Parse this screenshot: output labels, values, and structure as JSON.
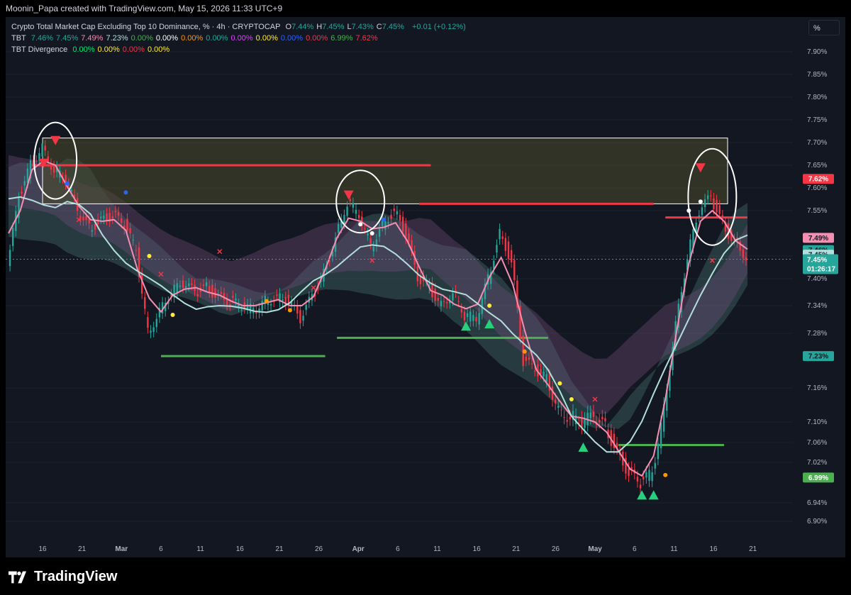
{
  "header": {
    "credit": "Moonin_Papa created with TradingView.com, May 15, 2026 11:33 UTC+9"
  },
  "legend": {
    "title": "Crypto Total Market Cap Excluding Top 10 Dominance, % · 4h · CRYPTOCAP",
    "ohlc": [
      {
        "k": "O",
        "v": "7.44%"
      },
      {
        "k": "H",
        "v": "7.45%"
      },
      {
        "k": "L",
        "v": "7.43%"
      },
      {
        "k": "C",
        "v": "7.45%"
      }
    ],
    "change": "+0.01 (+0.12%)",
    "tbt_label": "TBT",
    "tbt_values": [
      {
        "v": "7.46%",
        "color": "#26a69a"
      },
      {
        "v": "7.45%",
        "color": "#26a69a"
      },
      {
        "v": "7.49%",
        "color": "#f48fb1"
      },
      {
        "v": "7.23%",
        "color": "#b2dfdb"
      },
      {
        "v": "0.00%",
        "color": "#4caf50"
      },
      {
        "v": "0.00%",
        "color": "#ffffff"
      },
      {
        "v": "0.00%",
        "color": "#ff9800"
      },
      {
        "v": "0.00%",
        "color": "#26a69a"
      },
      {
        "v": "0.00%",
        "color": "#e040fb"
      },
      {
        "v": "0.00%",
        "color": "#ffeb3b"
      },
      {
        "v": "0.00%",
        "color": "#2962ff"
      },
      {
        "v": "0.00%",
        "color": "#f23645"
      },
      {
        "v": "6.99%",
        "color": "#4caf50"
      },
      {
        "v": "7.62%",
        "color": "#f23645"
      }
    ],
    "div_label": "TBT Divergence",
    "div_values": [
      {
        "v": "0.00%",
        "color": "#00e676"
      },
      {
        "v": "0.00%",
        "color": "#ffeb3b"
      },
      {
        "v": "0.00%",
        "color": "#f23645"
      },
      {
        "v": "0.00%",
        "color": "#ffeb3b"
      }
    ]
  },
  "scale_button": "%",
  "brand": "TradingView",
  "chart_data": {
    "type": "line",
    "title": "Crypto Total Market Cap Excluding Top 10 Dominance, %",
    "ylim": [
      6.86,
      7.95
    ],
    "ylabel_unit": "%",
    "y_ticks": [
      "7.90%",
      "7.85%",
      "7.80%",
      "7.75%",
      "7.70%",
      "7.65%",
      "7.60%",
      "7.55%",
      "7.45%",
      "7.40%",
      "7.34%",
      "7.28%",
      "7.16%",
      "7.10%",
      "7.06%",
      "7.02%",
      "6.94%",
      "6.90%"
    ],
    "y_tick_values": [
      7.9,
      7.85,
      7.8,
      7.75,
      7.7,
      7.65,
      7.6,
      7.55,
      7.45,
      7.4,
      7.34,
      7.28,
      7.16,
      7.1,
      7.06,
      7.02,
      6.94,
      6.9
    ],
    "x_ticks": [
      "16",
      "21",
      "Mar",
      "6",
      "11",
      "16",
      "21",
      "26",
      "Apr",
      "6",
      "11",
      "16",
      "21",
      "26",
      "May",
      "6",
      "11",
      "16",
      "21"
    ],
    "x_tick_index": [
      0,
      5,
      10,
      15,
      20,
      25,
      30,
      35,
      40,
      45,
      50,
      55,
      60,
      65,
      70,
      75,
      80,
      85,
      90
    ],
    "x_ticks_bold": [
      "Mar",
      "Apr",
      "May"
    ],
    "series": [
      {
        "name": "price",
        "values": [
          7.42,
          7.58,
          7.65,
          7.69,
          7.64,
          7.62,
          7.55,
          7.51,
          7.53,
          7.54,
          7.52,
          7.46,
          7.28,
          7.33,
          7.37,
          7.39,
          7.37,
          7.38,
          7.36,
          7.35,
          7.34,
          7.33,
          7.35,
          7.36,
          7.35,
          7.31,
          7.36,
          7.41,
          7.49,
          7.57,
          7.54,
          7.47,
          7.52,
          7.55,
          7.5,
          7.4,
          7.38,
          7.34,
          7.37,
          7.32,
          7.31,
          7.4,
          7.5,
          7.44,
          7.22,
          7.2,
          7.18,
          7.12,
          7.11,
          7.1,
          7.11,
          7.09,
          7.04,
          7.0,
          6.98,
          7.0,
          7.12,
          7.3,
          7.45,
          7.55,
          7.58,
          7.52,
          7.48,
          7.45
        ]
      }
    ],
    "value_pills": [
      {
        "text": "7.62%",
        "value": 7.62,
        "bg": "#f23645",
        "color": "#ffffff"
      },
      {
        "text": "7.49%",
        "value": 7.49,
        "bg": "#f48fb1",
        "color": "#131722"
      },
      {
        "text": "7.46%",
        "value": 7.463,
        "bg": "#26a69a",
        "color": "#131722"
      },
      {
        "text": "7.45%",
        "value": 7.453,
        "bg": "#b2dfdb",
        "color": "#131722"
      },
      {
        "text": "7.23%",
        "value": 7.23,
        "bg": "#26a69a",
        "color": "#131722"
      },
      {
        "text": "6.99%",
        "value": 6.99,
        "bg": "#4caf50",
        "color": "#ffffff"
      }
    ],
    "current_pill": {
      "price": "7.45%",
      "time": "01:26:17",
      "value": 7.443
    },
    "resistance_zone": [
      7.565,
      7.71
    ],
    "levels": [
      {
        "value": 7.65,
        "from": 2,
        "to": 36,
        "color": "#f23645"
      },
      {
        "value": 7.565,
        "from": 35,
        "to": 55,
        "color": "#f23645"
      },
      {
        "value": 7.535,
        "from": 56,
        "to": 79,
        "color": "#f23645"
      },
      {
        "value": 7.615,
        "from": 80,
        "to": 84,
        "color": "#f23645"
      },
      {
        "value": 7.23,
        "from": 13,
        "to": 27,
        "color": "#4caf50"
      },
      {
        "value": 7.27,
        "from": 28,
        "to": 46,
        "color": "#4caf50"
      },
      {
        "value": 6.99,
        "from": 71,
        "to": 88,
        "color": "#4caf50"
      },
      {
        "value": 7.055,
        "from": 52,
        "to": 61,
        "color": "#4caf50"
      }
    ]
  }
}
